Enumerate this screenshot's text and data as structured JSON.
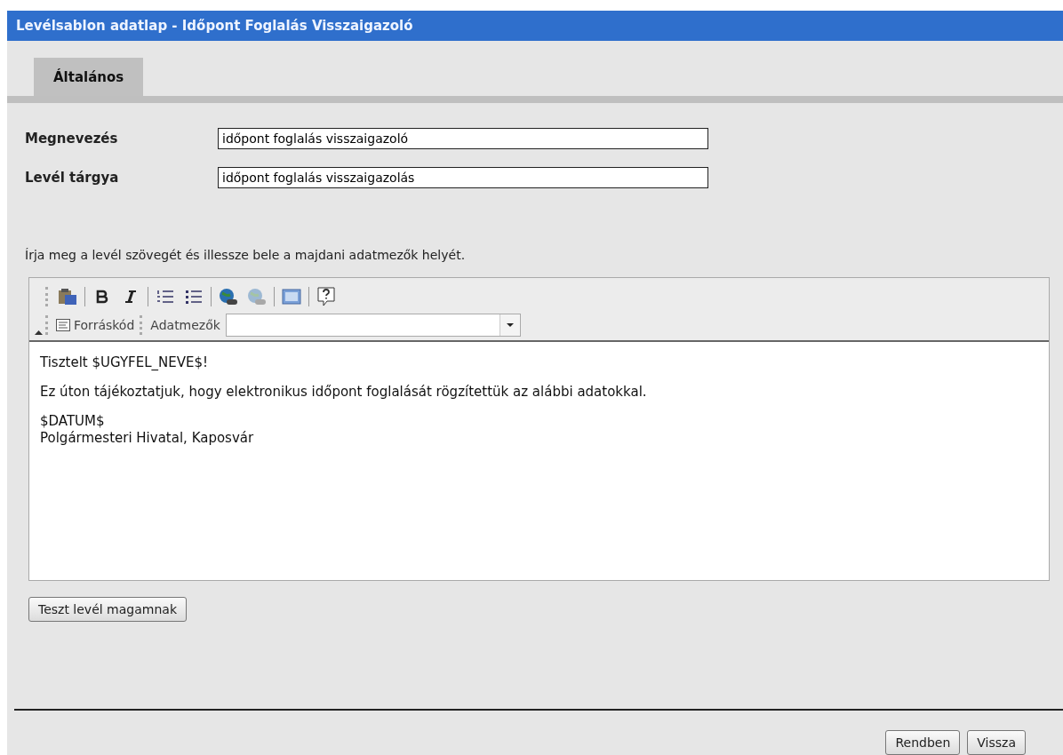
{
  "window": {
    "title": "Levélsablon adatlap - Időpont Foglalás Visszaigazoló"
  },
  "tabs": [
    {
      "label": "Általános",
      "selected": true
    }
  ],
  "fields": [
    {
      "label": "Megnevezés",
      "value": "időpont foglalás visszaigazoló"
    },
    {
      "label": "Levél tárgya",
      "value": "időpont foglalás visszaigazolás"
    }
  ],
  "instruction": "Írja meg a levél szövegét és illessze bele a majdani adatmezők helyét.",
  "editor": {
    "toolbar": [
      {
        "kind": "paste-word",
        "disabled": false
      },
      {
        "kind": "separator"
      },
      {
        "kind": "bold",
        "disabled": false
      },
      {
        "kind": "italic",
        "disabled": false
      },
      {
        "kind": "separator"
      },
      {
        "kind": "ordered-list",
        "disabled": false
      },
      {
        "kind": "bullet-list",
        "disabled": false
      },
      {
        "kind": "separator"
      },
      {
        "kind": "link",
        "disabled": false
      },
      {
        "kind": "unlink",
        "disabled": true
      },
      {
        "kind": "separator"
      },
      {
        "kind": "frame",
        "disabled": false
      },
      {
        "kind": "separator"
      },
      {
        "kind": "help",
        "disabled": false
      }
    ],
    "source_button": "Forráskód",
    "fields_label": "Adatmezők",
    "content": [
      [
        "Tisztelt $UGYFEL_NEVE$!"
      ],
      [
        "Ez úton tájékoztatjuk, hogy elektronikus időpont foglalását rögzítettük az alábbi adatokkal."
      ],
      [
        "$DATUM$",
        "Polgármesteri Hivatal, Kaposvár"
      ]
    ]
  },
  "test_button": "Teszt levél magamnak",
  "buttons": [
    "Rendben",
    "Vissza"
  ]
}
